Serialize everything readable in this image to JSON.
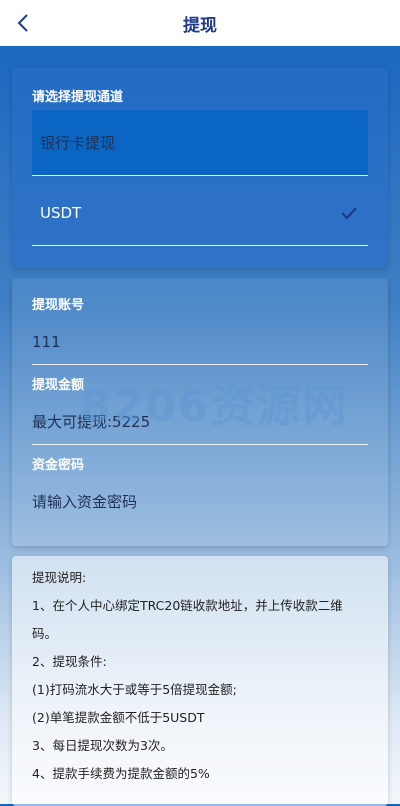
{
  "header": {
    "title": "提现",
    "back_icon": "chevron-left-icon"
  },
  "channel": {
    "label": "请选择提现通道",
    "options": [
      {
        "label": "银行卡提现",
        "selected": true
      },
      {
        "label": "USDT",
        "checked": true
      }
    ]
  },
  "form": {
    "account_label": "提现账号",
    "account_value": "111",
    "amount_label": "提现金额",
    "amount_placeholder": "最大可提现:5225",
    "password_label": "资金密码",
    "password_placeholder": "请输入资金密码"
  },
  "notes": {
    "title": "提现说明:",
    "items": [
      "1、在个人中心绑定TRC20链收款地址，并上传收款二维",
      "码。",
      "2、提现条件:",
      "(1)打码流水大于或等于5倍提现金额;",
      "(2)单笔提款金额不低于5USDT",
      "3、每日提现次数为3次。",
      "4、提款手续费为提款金额的5%"
    ]
  },
  "watermark": "8206资源网",
  "colors": {
    "accent": "#0a66c2",
    "title": "#1f3a8a",
    "text_dark": "#1f2f55"
  }
}
